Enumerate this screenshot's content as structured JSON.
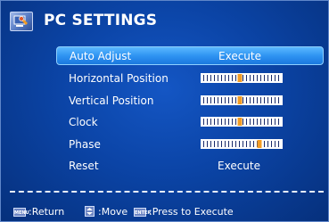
{
  "title": "PC SETTINGS",
  "menu": {
    "items": [
      {
        "label": "Auto Adjust",
        "value": "Execute"
      },
      {
        "label": "Horizontal Position",
        "level": 0.48
      },
      {
        "label": "Vertical Position",
        "level": 0.48
      },
      {
        "label": "Clock",
        "level": 0.48
      },
      {
        "label": "Phase",
        "level": 0.72
      },
      {
        "label": "Reset",
        "value": "Execute"
      }
    ]
  },
  "help": {
    "menu_key": "MENU",
    "return_label": ":Return",
    "move_label": ":Move",
    "enter_key": "ENTER",
    "execute_label": ":Press to Execute"
  },
  "colors": {
    "background": "#0b44a6",
    "selection": "#2f94f2",
    "slider_knob": "#f39c24"
  }
}
